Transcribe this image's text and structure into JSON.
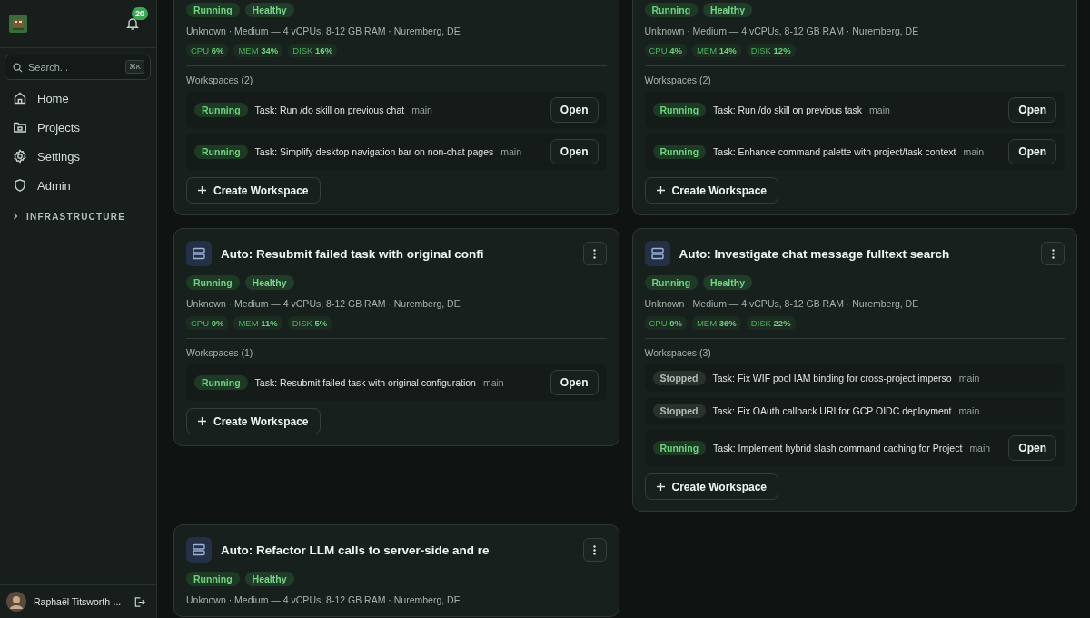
{
  "sidebar": {
    "notification_count": "20",
    "search": {
      "placeholder": "Search...",
      "shortcut": "⌘K"
    },
    "nav": [
      {
        "label": "Home",
        "kind": "home"
      },
      {
        "label": "Projects",
        "kind": "folder"
      },
      {
        "label": "Settings",
        "kind": "gear"
      },
      {
        "label": "Admin",
        "kind": "shield"
      }
    ],
    "sections": [
      {
        "label": "INFRASTRUCTURE",
        "expanded": false
      }
    ],
    "user": {
      "name": "Raphaël Titsworth-..."
    }
  },
  "servers": [
    {
      "badges": [
        {
          "label": "Running",
          "kind": "running"
        },
        {
          "label": "Healthy",
          "kind": "healthy"
        }
      ],
      "meta": "Unknown · Medium — 4 vCPUs, 8-12 GB RAM · Nuremberg, DE",
      "metrics": [
        {
          "label": "CPU",
          "value": "6%"
        },
        {
          "label": "MEM",
          "value": "34%"
        },
        {
          "label": "DISK",
          "value": "16%"
        }
      ],
      "workspaces_heading": "Workspaces (2)",
      "workspaces": [
        {
          "status": "Running",
          "kind": "running",
          "task": "Task: Run /do skill on previous chat",
          "branch": "main",
          "action": "Open"
        },
        {
          "status": "Running",
          "kind": "running",
          "task": "Task: Simplify desktop navigation bar on non-chat pages",
          "branch": "main",
          "action": "Open"
        }
      ],
      "create_button": "Create Workspace"
    },
    {
      "badges": [
        {
          "label": "Running",
          "kind": "running"
        },
        {
          "label": "Healthy",
          "kind": "healthy"
        }
      ],
      "meta": "Unknown · Medium — 4 vCPUs, 8-12 GB RAM · Nuremberg, DE",
      "metrics": [
        {
          "label": "CPU",
          "value": "4%"
        },
        {
          "label": "MEM",
          "value": "14%"
        },
        {
          "label": "DISK",
          "value": "12%"
        }
      ],
      "workspaces_heading": "Workspaces (2)",
      "workspaces": [
        {
          "status": "Running",
          "kind": "running",
          "task": "Task: Run /do skill on previous task",
          "branch": "main",
          "action": "Open"
        },
        {
          "status": "Running",
          "kind": "running",
          "task": "Task: Enhance command palette with project/task context",
          "branch": "main",
          "action": "Open"
        }
      ],
      "create_button": "Create Workspace"
    },
    {
      "title": "Auto: Resubmit failed task with original confi",
      "badges": [
        {
          "label": "Running",
          "kind": "running"
        },
        {
          "label": "Healthy",
          "kind": "healthy"
        }
      ],
      "meta": "Unknown · Medium — 4 vCPUs, 8-12 GB RAM · Nuremberg, DE",
      "metrics": [
        {
          "label": "CPU",
          "value": "0%"
        },
        {
          "label": "MEM",
          "value": "11%"
        },
        {
          "label": "DISK",
          "value": "5%"
        }
      ],
      "workspaces_heading": "Workspaces (1)",
      "workspaces": [
        {
          "status": "Running",
          "kind": "running",
          "task": "Task: Resubmit failed task with original configuration",
          "branch": "main",
          "action": "Open"
        }
      ],
      "create_button": "Create Workspace"
    },
    {
      "title": "Auto: Investigate chat message fulltext search",
      "badges": [
        {
          "label": "Running",
          "kind": "running"
        },
        {
          "label": "Healthy",
          "kind": "healthy"
        }
      ],
      "meta": "Unknown · Medium — 4 vCPUs, 8-12 GB RAM · Nuremberg, DE",
      "metrics": [
        {
          "label": "CPU",
          "value": "0%"
        },
        {
          "label": "MEM",
          "value": "36%"
        },
        {
          "label": "DISK",
          "value": "22%"
        }
      ],
      "workspaces_heading": "Workspaces (3)",
      "workspaces": [
        {
          "status": "Stopped",
          "kind": "stopped",
          "task": "Task: Fix WIF pool IAM binding for cross-project imperso",
          "branch": "main"
        },
        {
          "status": "Stopped",
          "kind": "stopped",
          "task": "Task: Fix OAuth callback URI for GCP OIDC deployment",
          "branch": "main"
        },
        {
          "status": "Running",
          "kind": "running",
          "task": "Task: Implement hybrid slash command caching for Project",
          "branch": "main",
          "action": "Open"
        }
      ],
      "create_button": "Create Workspace"
    },
    {
      "title": "Auto: Refactor LLM calls to server-side and re",
      "badges": [
        {
          "label": "Running",
          "kind": "running"
        },
        {
          "label": "Healthy",
          "kind": "healthy"
        }
      ],
      "meta": "Unknown · Medium — 4 vCPUs, 8-12 GB RAM · Nuremberg, DE"
    }
  ]
}
